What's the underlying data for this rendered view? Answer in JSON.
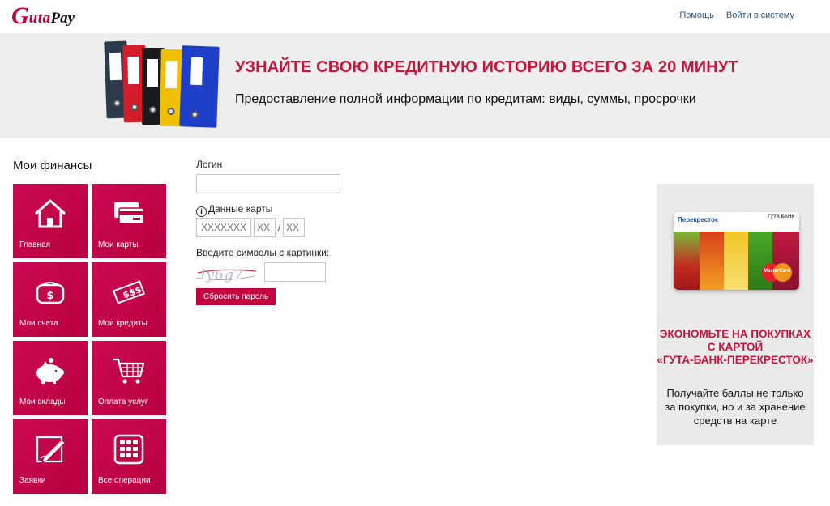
{
  "header": {
    "logo_g": "G",
    "logo_uta": "uta",
    "logo_pay": "Pay",
    "links": [
      "Помощь",
      "Войти в систему"
    ]
  },
  "banner": {
    "title": "УЗНАЙТЕ СВОЮ КРЕДИТНУЮ ИСТОРИЮ ВСЕГО ЗА 20 МИНУТ",
    "subtitle": "Предоставление полной информации по кредитам: виды, суммы, просрочки",
    "folder_colors": [
      "#2a3a4a",
      "#d41c2a",
      "#1a1a1a",
      "#f0c000",
      "#1e3fc8"
    ]
  },
  "menu": {
    "title": "Мои финансы",
    "items": [
      {
        "label": "Главная",
        "icon": "home-icon"
      },
      {
        "label": "Мои карты",
        "icon": "cards-icon"
      },
      {
        "label": "Мои счета",
        "icon": "wallet-icon"
      },
      {
        "label": "Мои кредиты",
        "icon": "money-icon"
      },
      {
        "label": "Мои вклады",
        "icon": "piggy-bank-icon"
      },
      {
        "label": "Оплата услуг",
        "icon": "shopping-cart-icon"
      },
      {
        "label": "Заявки",
        "icon": "pen-icon"
      },
      {
        "label": "Все операции",
        "icon": "calculator-icon"
      }
    ]
  },
  "form": {
    "login_label": "Логин",
    "login_value": "",
    "card_label": "Данные карты",
    "card_number_placeholder": "XXXXXXX",
    "card_month_placeholder": "XX",
    "card_separator": "/",
    "card_year_placeholder": "XX",
    "captcha_label": "Введите символы с картинки:",
    "captcha_text": "ly6g7",
    "captcha_value": "",
    "reset_button": "Сбросить пароль"
  },
  "promo": {
    "card_brand_left": "Перекресток",
    "card_brand_right": "ГУТА БАНК",
    "card_network": "MasterCard",
    "title_lines": [
      "ЭКОНОМЬТЕ НА ПОКУПКАХ",
      "С КАРТОЙ",
      "«ГУТА-БАНК-ПЕРЕКРЕСТОК»"
    ],
    "text_lines": [
      "Получайте баллы не только",
      "за покупки, но и за хранение",
      "средств на карте"
    ]
  },
  "colors": {
    "accent": "#c4003f",
    "banner_bg": "#eeeeef",
    "promo_bg": "#eaeaeb",
    "link": "#2a5a8a"
  }
}
